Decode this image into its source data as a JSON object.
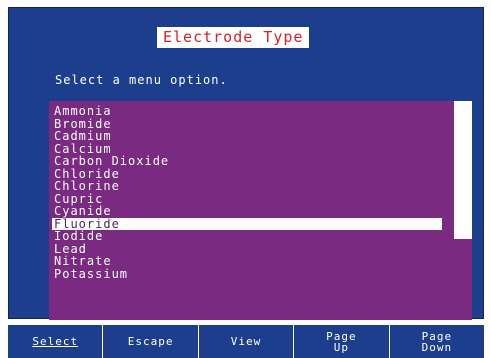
{
  "colors": {
    "panel_bg": "#1d3e8c",
    "list_bg": "#7a2a80",
    "title_text": "#d8202a",
    "highlight_bg": "#ffffff"
  },
  "header": {
    "title": "Electrode Type"
  },
  "prompt": "Select a menu option.",
  "list": {
    "items": [
      "Ammonia",
      "Bromide",
      "Cadmium",
      "Calcium",
      "Carbon Dioxide",
      "Chloride",
      "Chlorine",
      "Cupric",
      "Cyanide",
      "Fluoride",
      "Iodide",
      "Lead",
      "Nitrate",
      "Potassium"
    ],
    "selected_index": 9
  },
  "softkeys": {
    "select": "Select",
    "escape": "Escape",
    "view": "View",
    "page_up": "Page\nUp",
    "page_down": "Page\nDown"
  }
}
